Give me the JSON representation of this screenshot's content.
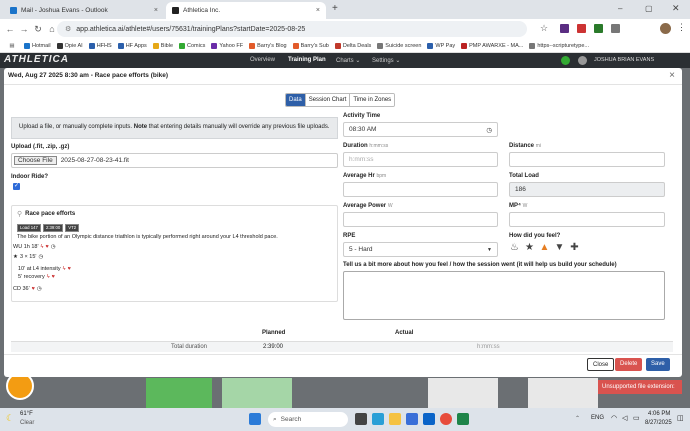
{
  "browser": {
    "tabs": [
      {
        "title": "Mail - Joshua Evans - Outlook",
        "active": false
      },
      {
        "title": "Athletica Inc.",
        "active": true
      }
    ],
    "new_tab": "+",
    "url": "app.athletica.ai/athlete#/users/75631/trainingPlans?startDate=2025-08-25",
    "bookmarks": [
      "Hotmail",
      "Opie AI",
      "HFHS",
      "HF Apps",
      "Bible",
      "Comics",
      "Yahoo FF",
      "Barry's Blog",
      "Barry's Sub",
      "Delta Deals",
      "Suicide screen",
      "WP Pay",
      "PMP AWARXE - MA...",
      "https--scripturetype..."
    ]
  },
  "app": {
    "logo": "ATHLETICA",
    "nav": [
      "Overview",
      "Training Plan",
      "Charts ⌄",
      "Settings ⌄"
    ],
    "user": "JOSHUA BRIAN EVANS"
  },
  "modal": {
    "title": "Wed, Aug 27 2025 8:30 am - Race pace efforts (bike)",
    "close": "×",
    "tabs": [
      "Data",
      "Session Chart",
      "Time in Zones"
    ],
    "info_prefix": "Upload a file, or manually complete inputs.",
    "info_note_label": "Note",
    "info_note": "that entering details manually will override any previous file uploads.",
    "upload_label": "Upload (.fit, .zip, .gz)",
    "choose_file": "Choose File",
    "file_name": "2025-08-27-08-23-41.fit",
    "indoor_label": "Indoor Ride?",
    "indoor_checked": "✓",
    "workout": {
      "title": "Race pace efforts",
      "badges": [
        "Load 147",
        "2:39:00",
        "VT2"
      ],
      "description": "The bike portion of an Olympic distance triathlon is typically performed right around your L4 threshold pace.",
      "steps": [
        "WU 1h 18'",
        "3 × 15'",
        "10' at L4 intensity",
        "5' recovery",
        "CD 36'"
      ]
    },
    "activity_time_label": "Activity Time",
    "activity_time": "08:30 AM",
    "duration_label": "Duration",
    "duration_unit": "h:mm:ss",
    "duration_placeholder": "h:mm:ss",
    "distance_label": "Distance",
    "distance_unit": "mi",
    "avg_hr_label": "Average Hr",
    "avg_hr_unit": "bpm",
    "total_load_label": "Total Load",
    "total_load": "186",
    "avg_power_label": "Average Power",
    "avg_power_unit": "W",
    "mp_label": "MP⁴",
    "mp_unit": "W",
    "rpe_label": "RPE",
    "rpe_value": "5 - Hard",
    "feel_label": "How did you feel?",
    "feel_question": "Tell us a bit more about how you feel / how the session went (it will help us build your schedule)",
    "table": {
      "col_planned": "Planned",
      "col_actual": "Actual",
      "row_label": "Total duration",
      "planned": "2:39:00",
      "actual_placeholder": "h:mm:ss"
    },
    "buttons": {
      "close": "Close",
      "delete": "Delete",
      "save": "Save"
    }
  },
  "toast": "Unsupported file extension:",
  "taskbar": {
    "temp": "61°F",
    "weather": "Clear",
    "search": "Search",
    "lang": "ENG",
    "time": "4:06 PM",
    "date": "8/27/2025"
  },
  "colors": {
    "primary": "#2e5fa8",
    "danger": "#d9534f",
    "navbar": "#2b2f33"
  }
}
